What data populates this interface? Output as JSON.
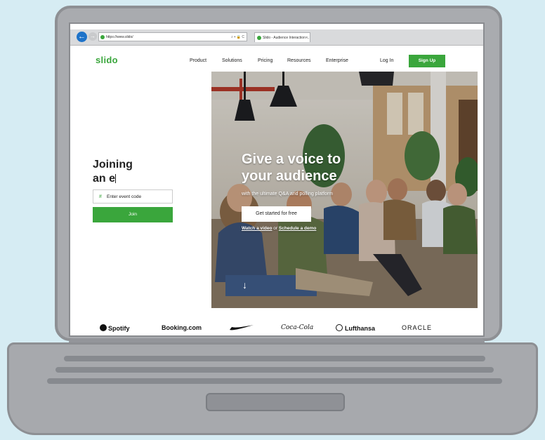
{
  "browser": {
    "url": "https://www.slido/",
    "address_icons": "⌕ ▾ 🔒 C",
    "tab_title": "Slido - Audience Interaction ...",
    "tab_close": "×",
    "back": "←",
    "forward": "→"
  },
  "nav": {
    "logo": "slido",
    "items": [
      "Product",
      "Solutions",
      "Pricing",
      "Resources",
      "Enterprise"
    ],
    "login": "Log In",
    "signup": "Sign Up"
  },
  "join": {
    "title_line1": "Joining",
    "title_line2": "an e",
    "hash": "#",
    "placeholder": "Enter event code",
    "button": "Join"
  },
  "hero": {
    "title_line1": "Give a voice to",
    "title_line2": "your audience",
    "subtitle": "with the ultimate Q&A and polling platform",
    "cta": "Get started for free",
    "link1": "Watch a video",
    "connector": "or",
    "link2": "Schedule a demo",
    "down_arrow": "↓"
  },
  "brands": [
    "Spotify",
    "Booking.com",
    "Coca-Cola",
    "Lufthansa",
    "ORACLE"
  ],
  "colors": {
    "brand_green": "#3aa63c",
    "browser_blue": "#1e73c9"
  }
}
